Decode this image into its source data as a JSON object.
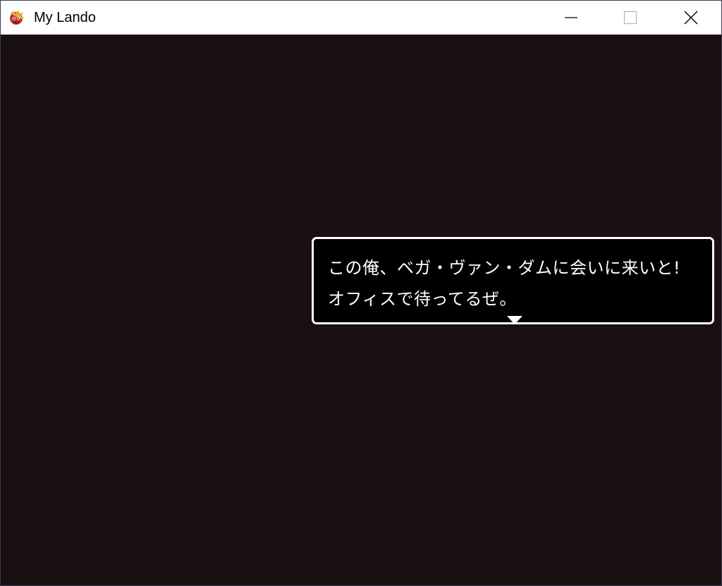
{
  "window": {
    "title": "My Lando",
    "icon": "game-app-icon",
    "controls": {
      "minimize_icon": "minimize-icon",
      "maximize_icon": "maximize-icon",
      "close_icon": "close-icon"
    }
  },
  "game": {
    "background_color": "#1a1011",
    "dialog": {
      "lines": [
        "この俺、ベガ・ヴァン・ダムに会いに来いと!",
        "オフィスで待ってるぜ。"
      ],
      "advance_indicator": "triangle-down-icon"
    }
  }
}
